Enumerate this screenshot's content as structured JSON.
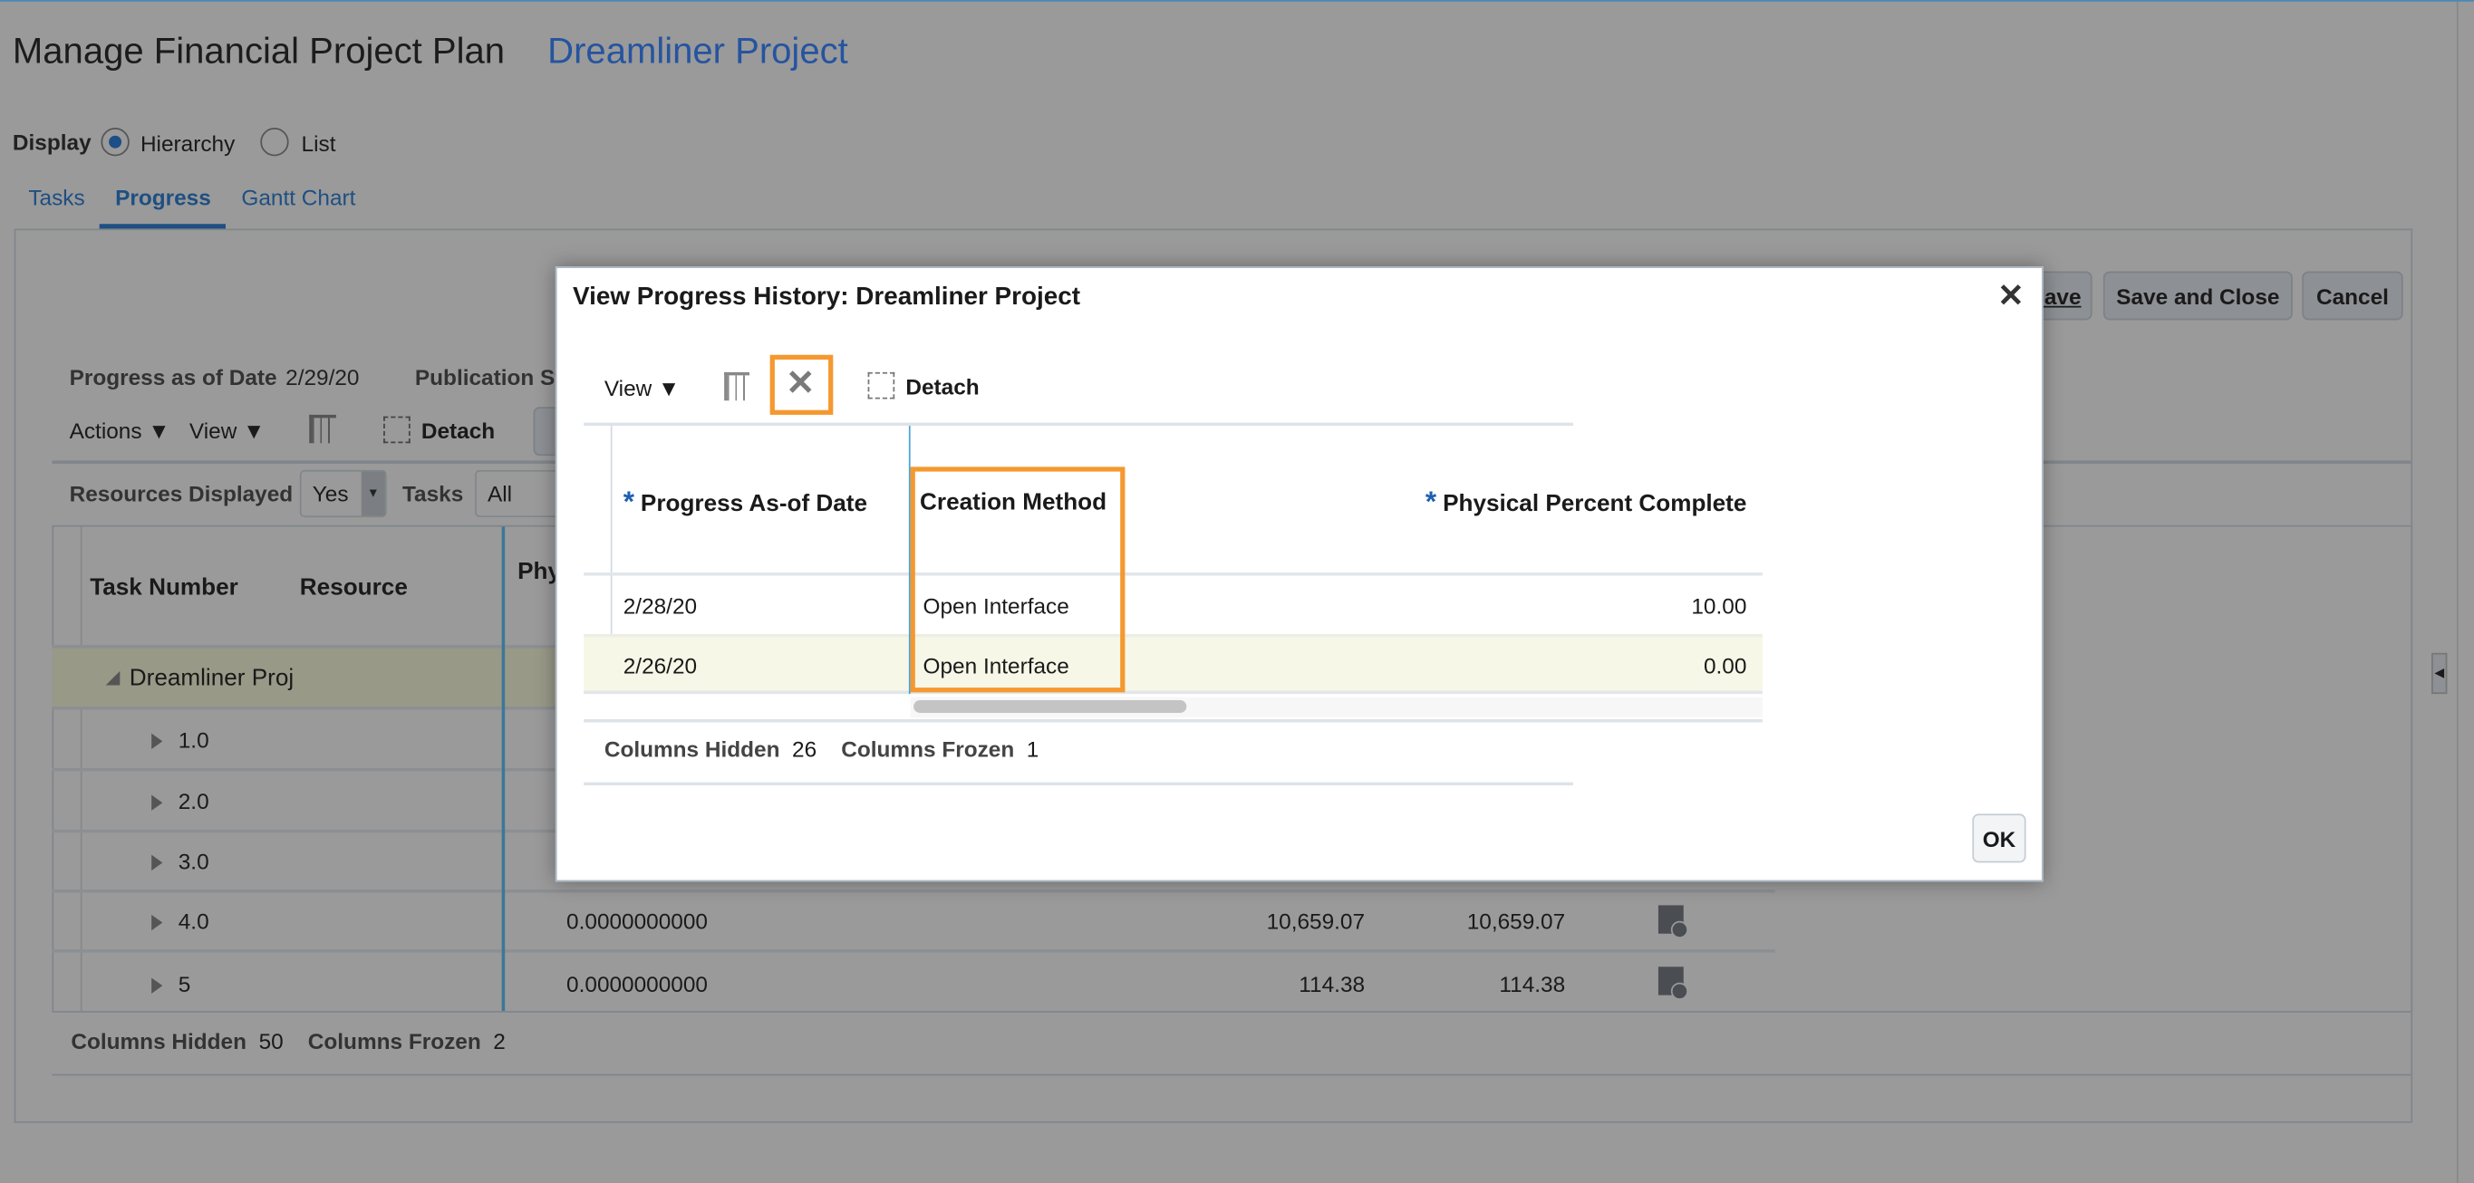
{
  "page": {
    "title": "Manage Financial Project Plan",
    "project": "Dreamliner Project"
  },
  "display": {
    "label": "Display",
    "options": [
      "Hierarchy",
      "List"
    ],
    "selected": "Hierarchy"
  },
  "tabs": [
    {
      "label": "Tasks"
    },
    {
      "label": "Progress",
      "active": true
    },
    {
      "label": "Gantt Chart"
    }
  ],
  "buttons": {
    "save": "Save",
    "save_close": "Save and Close",
    "cancel": "Cancel"
  },
  "info": {
    "progress_date_label": "Progress as of Date",
    "progress_date": "2/29/20",
    "publication_label": "Publication St"
  },
  "toolbar": {
    "actions": "Actions",
    "view": "View",
    "detach": "Detach"
  },
  "filters": {
    "resources_label": "Resources Displayed",
    "resources_value": "Yes",
    "tasks_label": "Tasks",
    "tasks_value": "All"
  },
  "table": {
    "headers": [
      "Task Number",
      "Resource",
      "Phy"
    ],
    "rows": [
      {
        "task": "Dreamliner Proj",
        "value": "",
        "c1": "",
        "c2": ""
      },
      {
        "task": "1.0",
        "value": "",
        "c1": "",
        "c2": ""
      },
      {
        "task": "2.0",
        "value": "",
        "c1": "",
        "c2": ""
      },
      {
        "task": "3.0",
        "value": "",
        "c1": "",
        "c2": ""
      },
      {
        "task": "4.0",
        "value": "0.0000000000",
        "c1": "10,659.07",
        "c2": "10,659.07"
      },
      {
        "task": "5",
        "value": "0.0000000000",
        "c1": "114.38",
        "c2": "114.38"
      }
    ],
    "footer": {
      "hidden_label": "Columns Hidden",
      "hidden": "50",
      "frozen_label": "Columns Frozen",
      "frozen": "2"
    }
  },
  "modal": {
    "title": "View Progress History: Dreamliner Project",
    "view": "View",
    "detach": "Detach",
    "headers": {
      "date": "Progress As-of Date",
      "method": "Creation Method",
      "percent": "Physical Percent Complete",
      "required": "*"
    },
    "rows": [
      {
        "date": "2/28/20",
        "method": "Open Interface",
        "percent": "10.00"
      },
      {
        "date": "2/26/20",
        "method": "Open Interface",
        "percent": "0.00"
      }
    ],
    "footer": {
      "hidden_label": "Columns Hidden",
      "hidden": "26",
      "frozen_label": "Columns Frozen",
      "frozen": "1"
    },
    "ok": "OK"
  },
  "colors": {
    "highlight": "#f5982f",
    "link": "#2f63b5"
  }
}
